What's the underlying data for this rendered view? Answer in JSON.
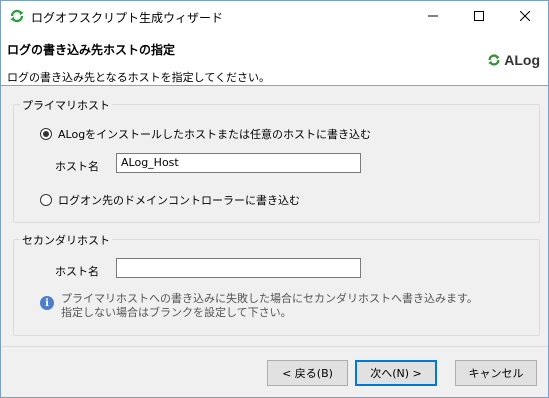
{
  "window": {
    "title": "ログオフスクリプト生成ウィザード"
  },
  "header": {
    "title": "ログの書き込み先ホストの指定",
    "subtitle": "ログの書き込み先となるホストを指定してください。",
    "logo_text": "ALog"
  },
  "primary": {
    "group_label": "プライマリホスト",
    "option1": "ALogをインストールしたホストまたは任意のホストに書き込む",
    "host_label": "ホスト名",
    "host_value": "ALog_Host",
    "option2": "ログオン先のドメインコントローラーに書き込む",
    "selected_option": 1
  },
  "secondary": {
    "group_label": "セカンダリホスト",
    "host_label": "ホスト名",
    "host_value": "",
    "info_line1": "プライマリホストへの書き込みに失敗した場合にセカンダリホストへ書き込みます。",
    "info_line2": "指定しない場合はブランクを設定して下さい。"
  },
  "buttons": {
    "back": "< 戻る(B)",
    "next": "次へ(N) >",
    "cancel": "キャンセル"
  },
  "colors": {
    "accent": "#0078d7",
    "logo_green": "#3a8f3a",
    "info_blue": "#4d7fc9"
  }
}
